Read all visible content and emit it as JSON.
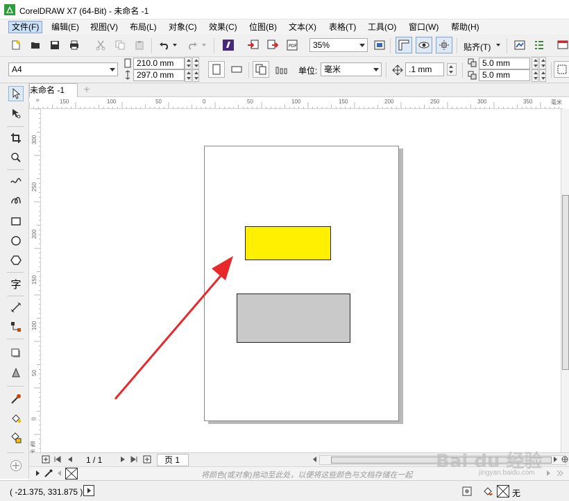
{
  "window": {
    "title": "CorelDRAW X7 (64-Bit) - 未命名 -1"
  },
  "menu": [
    "文件(F)",
    "编辑(E)",
    "视图(V)",
    "布局(L)",
    "对象(C)",
    "效果(C)",
    "位图(B)",
    "文本(X)",
    "表格(T)",
    "工具(O)",
    "窗口(W)",
    "帮助(H)"
  ],
  "toolbar": {
    "zoom": "35%",
    "snap_label": "贴齐(T)"
  },
  "propbar": {
    "paper_size": "A4",
    "width": "210.0 mm",
    "height": "297.0 mm",
    "units_label": "单位:",
    "units_value": "毫米",
    "nudge": ".1 mm",
    "dup_x": "5.0 mm",
    "dup_y": "5.0 mm"
  },
  "document": {
    "tab_label": "未命名 -1",
    "add_tab": "+"
  },
  "ruler": {
    "h_ticks": [
      "150",
      "100",
      "50",
      "0",
      "50",
      "100",
      "150",
      "200",
      "250",
      "300",
      "350"
    ],
    "h_unit": "毫米",
    "v_ticks": [
      "300",
      "250",
      "200",
      "150",
      "100",
      "50",
      "0"
    ],
    "v_unit": "毫米"
  },
  "pager": {
    "count": "1 / 1",
    "page_tab": "页 1"
  },
  "colorbar": {
    "hint": "将颜色(或对象)拖动至此处，以便将这些颜色与文档存储在一起"
  },
  "status": {
    "coords": "( -21.375, 331.875 )",
    "fill": "无"
  },
  "watermark": {
    "brand": "Bai du 经验",
    "url": "jingyan.baidu.com"
  },
  "colors": {
    "yellow_rect": "#ffef00",
    "gray_rect": "#c8c9c8",
    "arrow": "#e8282a",
    "menu_active": "#c9e0f7"
  }
}
